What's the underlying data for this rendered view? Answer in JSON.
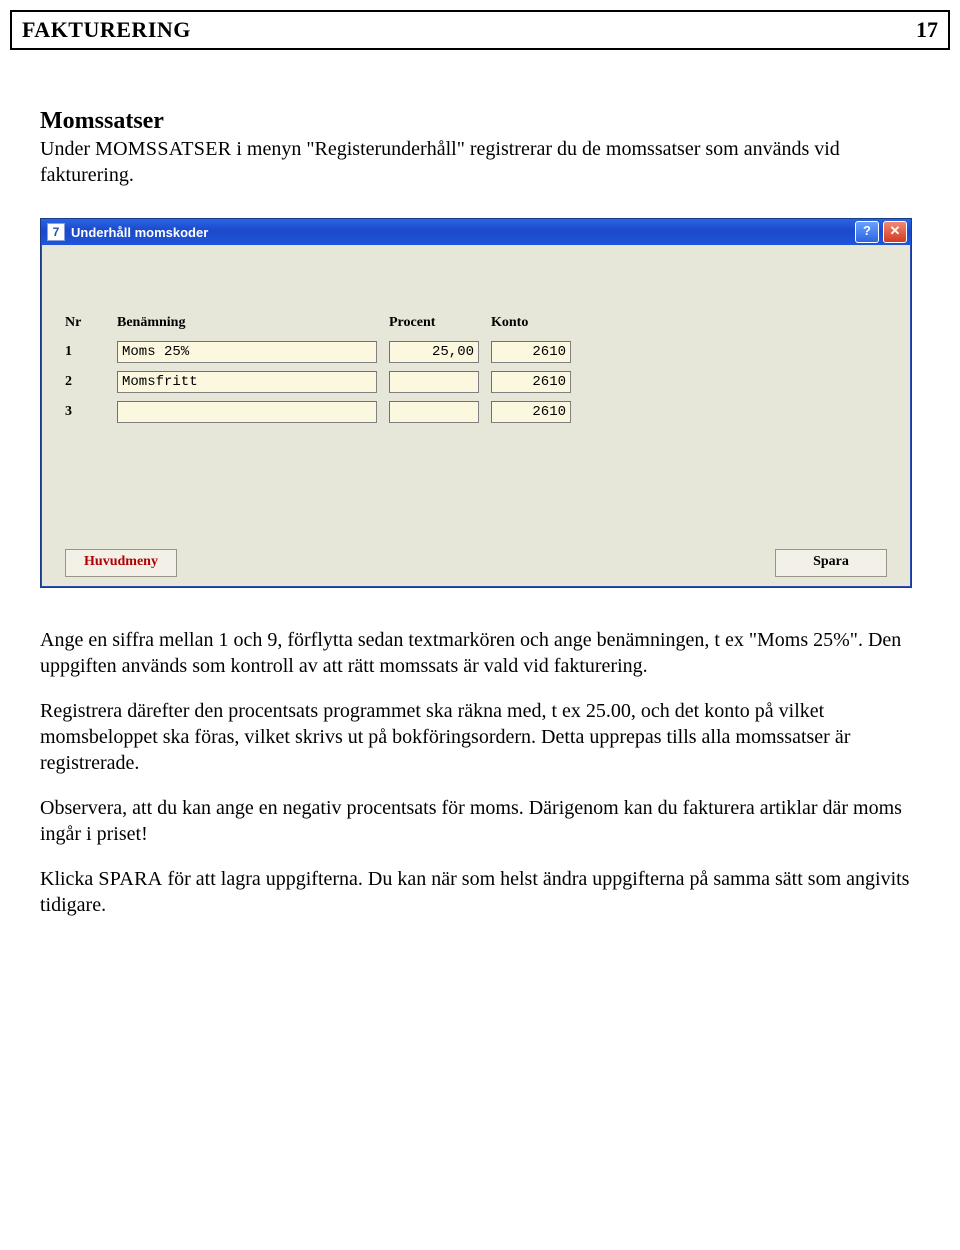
{
  "header": {
    "title": "FAKTURERING",
    "page_number": "17"
  },
  "section": {
    "heading": "Momssatser",
    "intro_a": "Under ",
    "intro_sc": "MOMSSATSER",
    "intro_b": " i menyn \"Registerunderhåll\" registrerar du de momssatser som används vid fakturering."
  },
  "dialog": {
    "app_icon_text": "7",
    "title": "Underhåll momskoder",
    "help_glyph": "?",
    "close_glyph": "✕",
    "columns": {
      "nr": "Nr",
      "name": "Benämning",
      "percent": "Procent",
      "account": "Konto"
    },
    "rows": [
      {
        "nr": "1",
        "name": "Moms 25%",
        "percent": "25,00",
        "account": "2610"
      },
      {
        "nr": "2",
        "name": "Momsfritt",
        "percent": "",
        "account": "2610"
      },
      {
        "nr": "3",
        "name": "",
        "percent": "",
        "account": "2610"
      }
    ],
    "buttons": {
      "main_menu": "Huvudmeny",
      "save": "Spara"
    }
  },
  "paragraphs": {
    "p1": "Ange en siffra mellan 1 och 9, förflytta sedan textmarkören och ange benämningen, t ex \"Moms 25%\". Den uppgiften används som kontroll av att rätt momssats är vald vid fakturering.",
    "p2": "Registrera därefter den procentsats programmet ska räkna med, t ex 25.00, och det konto på vilket momsbeloppet ska föras, vilket skrivs ut på bokföringsordern. Detta upprepas tills alla momssatser är registrerade.",
    "p3": "Observera, att du kan ange en negativ procentsats för moms. Därigenom kan du fakturera artiklar där moms ingår i priset!",
    "p4_a": "Klicka ",
    "p4_sc": "SPARA",
    "p4_b": " för att lagra uppgifterna. Du kan när som helst ändra uppgifterna på samma sätt som angivits tidigare."
  }
}
